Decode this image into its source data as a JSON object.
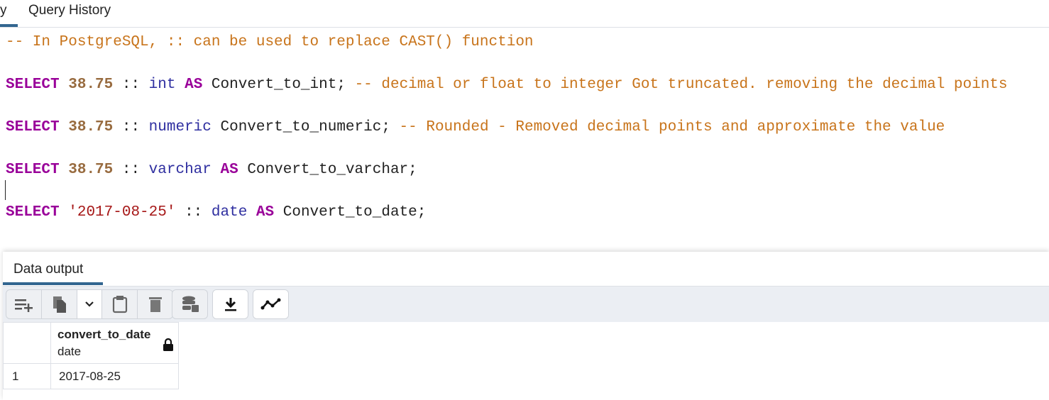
{
  "tabs": [
    {
      "label": "y"
    },
    {
      "label": "Query History"
    }
  ],
  "editor": {
    "lines": [
      [
        {
          "t": "-- In PostgreSQL, :: can be used to replace CAST() function",
          "c": "cm"
        }
      ],
      [
        {
          "t": "SELECT",
          "c": "kw"
        },
        {
          "t": " ",
          "c": "id"
        },
        {
          "t": "38.75",
          "c": "num"
        },
        {
          "t": " :: ",
          "c": "id"
        },
        {
          "t": "int",
          "c": "ty"
        },
        {
          "t": " ",
          "c": "id"
        },
        {
          "t": "AS",
          "c": "kw"
        },
        {
          "t": " Convert_to_int; ",
          "c": "id"
        },
        {
          "t": "-- decimal or float to integer Got truncated. removing the decimal points",
          "c": "cm"
        }
      ],
      [
        {
          "t": "SELECT",
          "c": "kw"
        },
        {
          "t": " ",
          "c": "id"
        },
        {
          "t": "38.75",
          "c": "num"
        },
        {
          "t": " :: ",
          "c": "id"
        },
        {
          "t": "numeric",
          "c": "ty"
        },
        {
          "t": " Convert_to_numeric; ",
          "c": "id"
        },
        {
          "t": "-- Rounded - Removed decimal points and approximate the value",
          "c": "cm"
        }
      ],
      [
        {
          "t": "SELECT",
          "c": "kw"
        },
        {
          "t": " ",
          "c": "id"
        },
        {
          "t": "38.75",
          "c": "num"
        },
        {
          "t": " :: ",
          "c": "id"
        },
        {
          "t": "varchar",
          "c": "ty"
        },
        {
          "t": " ",
          "c": "id"
        },
        {
          "t": "AS",
          "c": "kw"
        },
        {
          "t": " Convert_to_varchar;",
          "c": "id"
        }
      ],
      [
        {
          "t": "SELECT",
          "c": "kw"
        },
        {
          "t": " ",
          "c": "id"
        },
        {
          "t": "'2017-08-25'",
          "c": "st"
        },
        {
          "t": " :: ",
          "c": "id"
        },
        {
          "t": "date",
          "c": "ty"
        },
        {
          "t": " ",
          "c": "id"
        },
        {
          "t": "AS",
          "c": "kw"
        },
        {
          "t": " Convert_to_date;",
          "c": "id"
        }
      ]
    ]
  },
  "output": {
    "tab": "Data output",
    "columns": [
      {
        "name": "convert_to_date",
        "type": "date"
      }
    ],
    "rows": [
      {
        "num": "1",
        "values": [
          "2017-08-25"
        ]
      }
    ]
  }
}
